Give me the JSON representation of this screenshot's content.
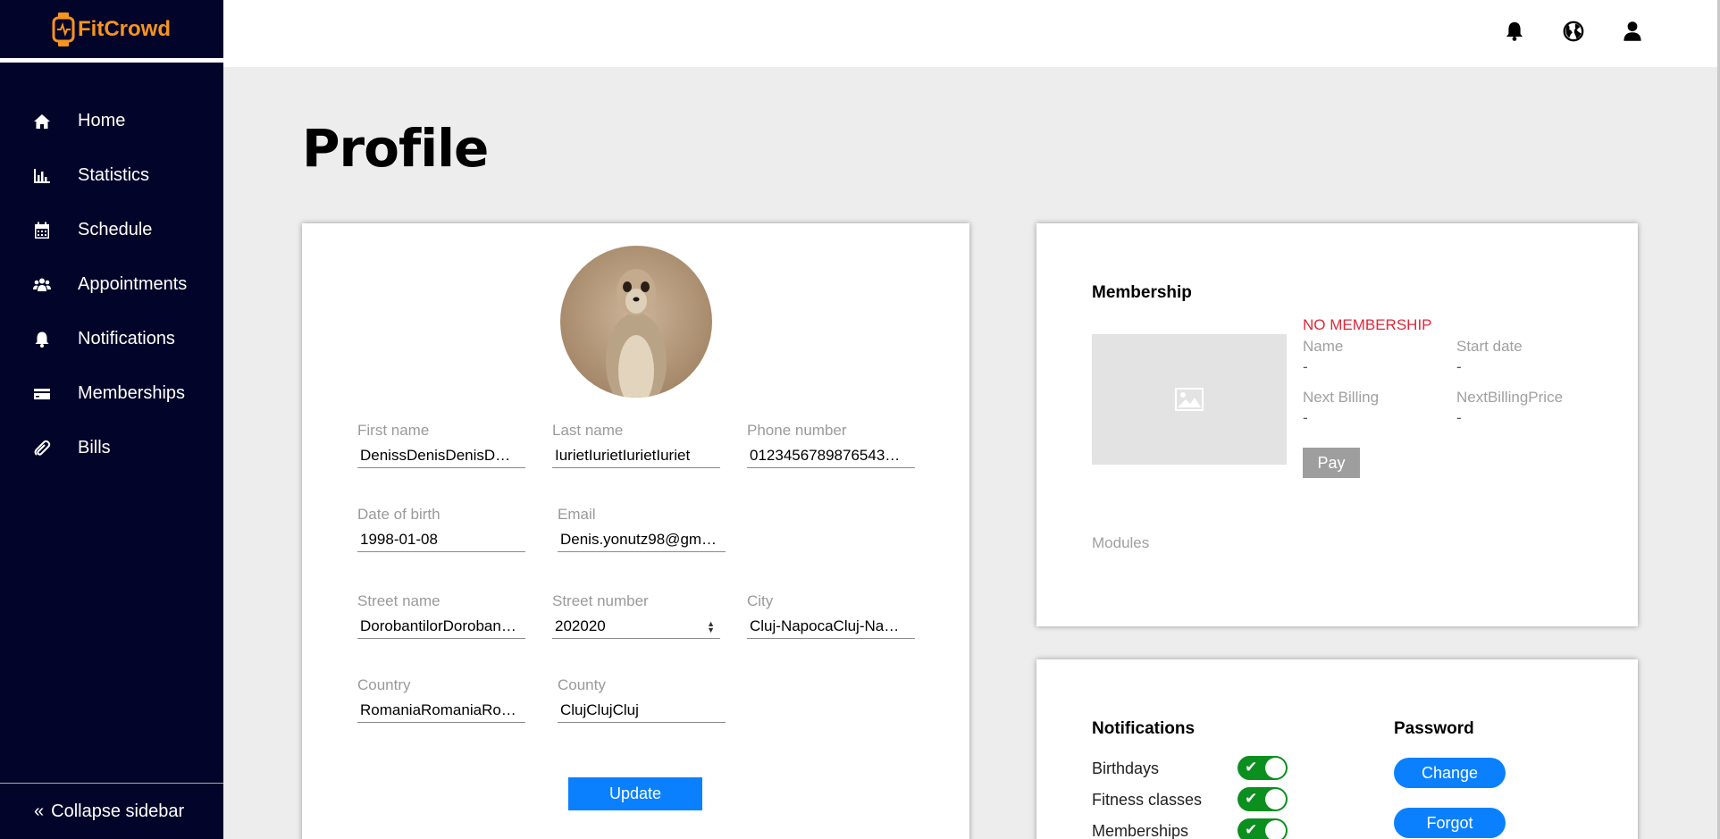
{
  "brand": {
    "name": "FitCrowd",
    "color": "#f7941d"
  },
  "sidebar": {
    "items": [
      {
        "label": "Home",
        "icon": "home-icon"
      },
      {
        "label": "Statistics",
        "icon": "bar-chart-icon"
      },
      {
        "label": "Schedule",
        "icon": "calendar-icon"
      },
      {
        "label": "Appointments",
        "icon": "users-icon"
      },
      {
        "label": "Notifications",
        "icon": "bell-icon"
      },
      {
        "label": "Memberships",
        "icon": "credit-card-icon"
      },
      {
        "label": "Bills",
        "icon": "paperclip-icon"
      }
    ],
    "collapse_label": "Collapse sidebar"
  },
  "header": {
    "icons": [
      "bell-icon",
      "globe-icon",
      "user-icon"
    ]
  },
  "page": {
    "title": "Profile"
  },
  "profile": {
    "first_name": {
      "label": "First name",
      "value": "DenissDenisDenisD…"
    },
    "last_name": {
      "label": "Last name",
      "value": "IurietIurietIurietIuriet"
    },
    "phone": {
      "label": "Phone number",
      "value": "0123456789876543…"
    },
    "dob": {
      "label": "Date of birth",
      "value": "1998-01-08"
    },
    "email": {
      "label": "Email",
      "value": "Denis.yonutz98@gm…"
    },
    "street_name": {
      "label": "Street name",
      "value": "DorobantilorDoroban…"
    },
    "street_number": {
      "label": "Street number",
      "value": "202020"
    },
    "city": {
      "label": "City",
      "value": "Cluj-NapocaCluj-Na…"
    },
    "country": {
      "label": "Country",
      "value": "RomaniaRomaniaRo…"
    },
    "county": {
      "label": "County",
      "value": "ClujClujCluj"
    },
    "update_label": "Update"
  },
  "membership": {
    "title": "Membership",
    "status": "NO MEMBERSHIP",
    "status_color": "#e0283a",
    "name_label": "Name",
    "name_value": "-",
    "start_label": "Start date",
    "start_value": "-",
    "billing_label": "Next Billing",
    "billing_value": "-",
    "price_label": "NextBillingPrice",
    "price_value": "-",
    "pay_label": "Pay",
    "modules_label": "Modules"
  },
  "settings": {
    "notifications_title": "Notifications",
    "toggles": [
      {
        "label": "Birthdays",
        "on": true
      },
      {
        "label": "Fitness classes",
        "on": true
      },
      {
        "label": "Memberships",
        "on": true
      }
    ],
    "password_title": "Password",
    "change_label": "Change",
    "forgot_label": "Forgot"
  }
}
